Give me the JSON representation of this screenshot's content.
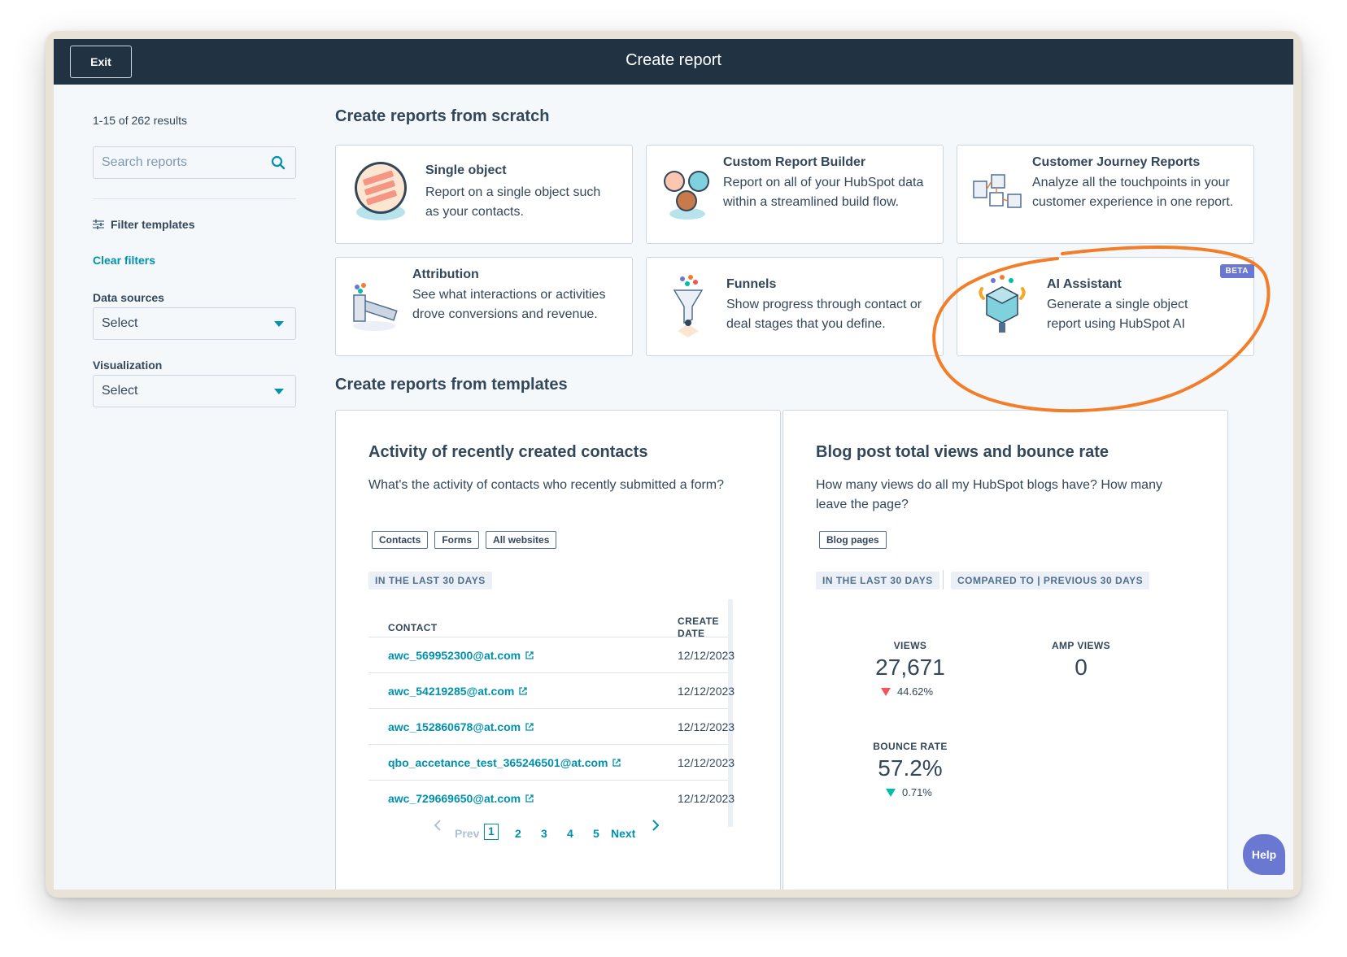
{
  "topbar": {
    "exit_label": "Exit",
    "title": "Create report"
  },
  "sidebar": {
    "results": "1-15 of 262 results",
    "search_placeholder": "Search reports",
    "filter_templates": "Filter templates",
    "clear_filters": "Clear filters",
    "data_sources_label": "Data sources",
    "data_sources_value": "Select",
    "visualization_label": "Visualization",
    "visualization_value": "Select"
  },
  "scratch": {
    "title": "Create reports from scratch",
    "cards": [
      {
        "title": "Single object",
        "desc": "Report on a single object such as your contacts."
      },
      {
        "title": "Custom Report Builder",
        "desc": "Report on all of your HubSpot data within a streamlined build flow."
      },
      {
        "title": "Customer Journey Reports",
        "desc": "Analyze all the touchpoints in your customer experience in one report."
      },
      {
        "title": "Attribution",
        "desc": "See what interactions or activities drove conversions and revenue."
      },
      {
        "title": "Funnels",
        "desc": "Show progress through contact or deal stages that you define."
      },
      {
        "title": "AI Assistant",
        "desc": "Generate a single object report using HubSpot AI",
        "badge": "BETA"
      }
    ]
  },
  "templates": {
    "title": "Create reports from templates",
    "activity": {
      "title": "Activity of recently created contacts",
      "desc": "What's the activity of contacts who recently submitted a form?",
      "tags": [
        "Contacts",
        "Forms",
        "All websites"
      ],
      "range": "IN THE LAST 30 DAYS",
      "col_contact": "CONTACT",
      "col_date": "CREATE DATE",
      "rows": [
        {
          "contact": "awc_569952300@at.com",
          "date": "12/12/2023"
        },
        {
          "contact": "awc_54219285@at.com",
          "date": "12/12/2023"
        },
        {
          "contact": "awc_152860678@at.com",
          "date": "12/12/2023"
        },
        {
          "contact": "qbo_accetance_test_365246501@at.com",
          "date": "12/12/2023"
        },
        {
          "contact": "awc_729669650@at.com",
          "date": "12/12/2023"
        }
      ],
      "pager": {
        "prev": "Prev",
        "pages": [
          "1",
          "2",
          "3",
          "4",
          "5"
        ],
        "next": "Next",
        "current": "1"
      }
    },
    "blog": {
      "title": "Blog post total views and bounce rate",
      "desc": "How many views do all my HubSpot blogs have? How many leave the page?",
      "tags": [
        "Blog pages"
      ],
      "range": "IN THE LAST 30 DAYS",
      "compare": "COMPARED TO | PREVIOUS 30 DAYS",
      "metrics": [
        {
          "label": "VIEWS",
          "value": "27,671",
          "change": "44.62%",
          "direction": "down"
        },
        {
          "label": "AMP VIEWS",
          "value": "0",
          "change": "",
          "direction": ""
        },
        {
          "label": "BOUNCE RATE",
          "value": "57.2%",
          "change": "0.71%",
          "direction": "down-good"
        }
      ]
    }
  },
  "help_label": "Help",
  "colors": {
    "topbar": "#213343",
    "link": "#0091ae",
    "beta": "#6a78d1",
    "annotation": "#f27e2a",
    "down_bad": "#f2545b",
    "down_good": "#00bda5"
  }
}
